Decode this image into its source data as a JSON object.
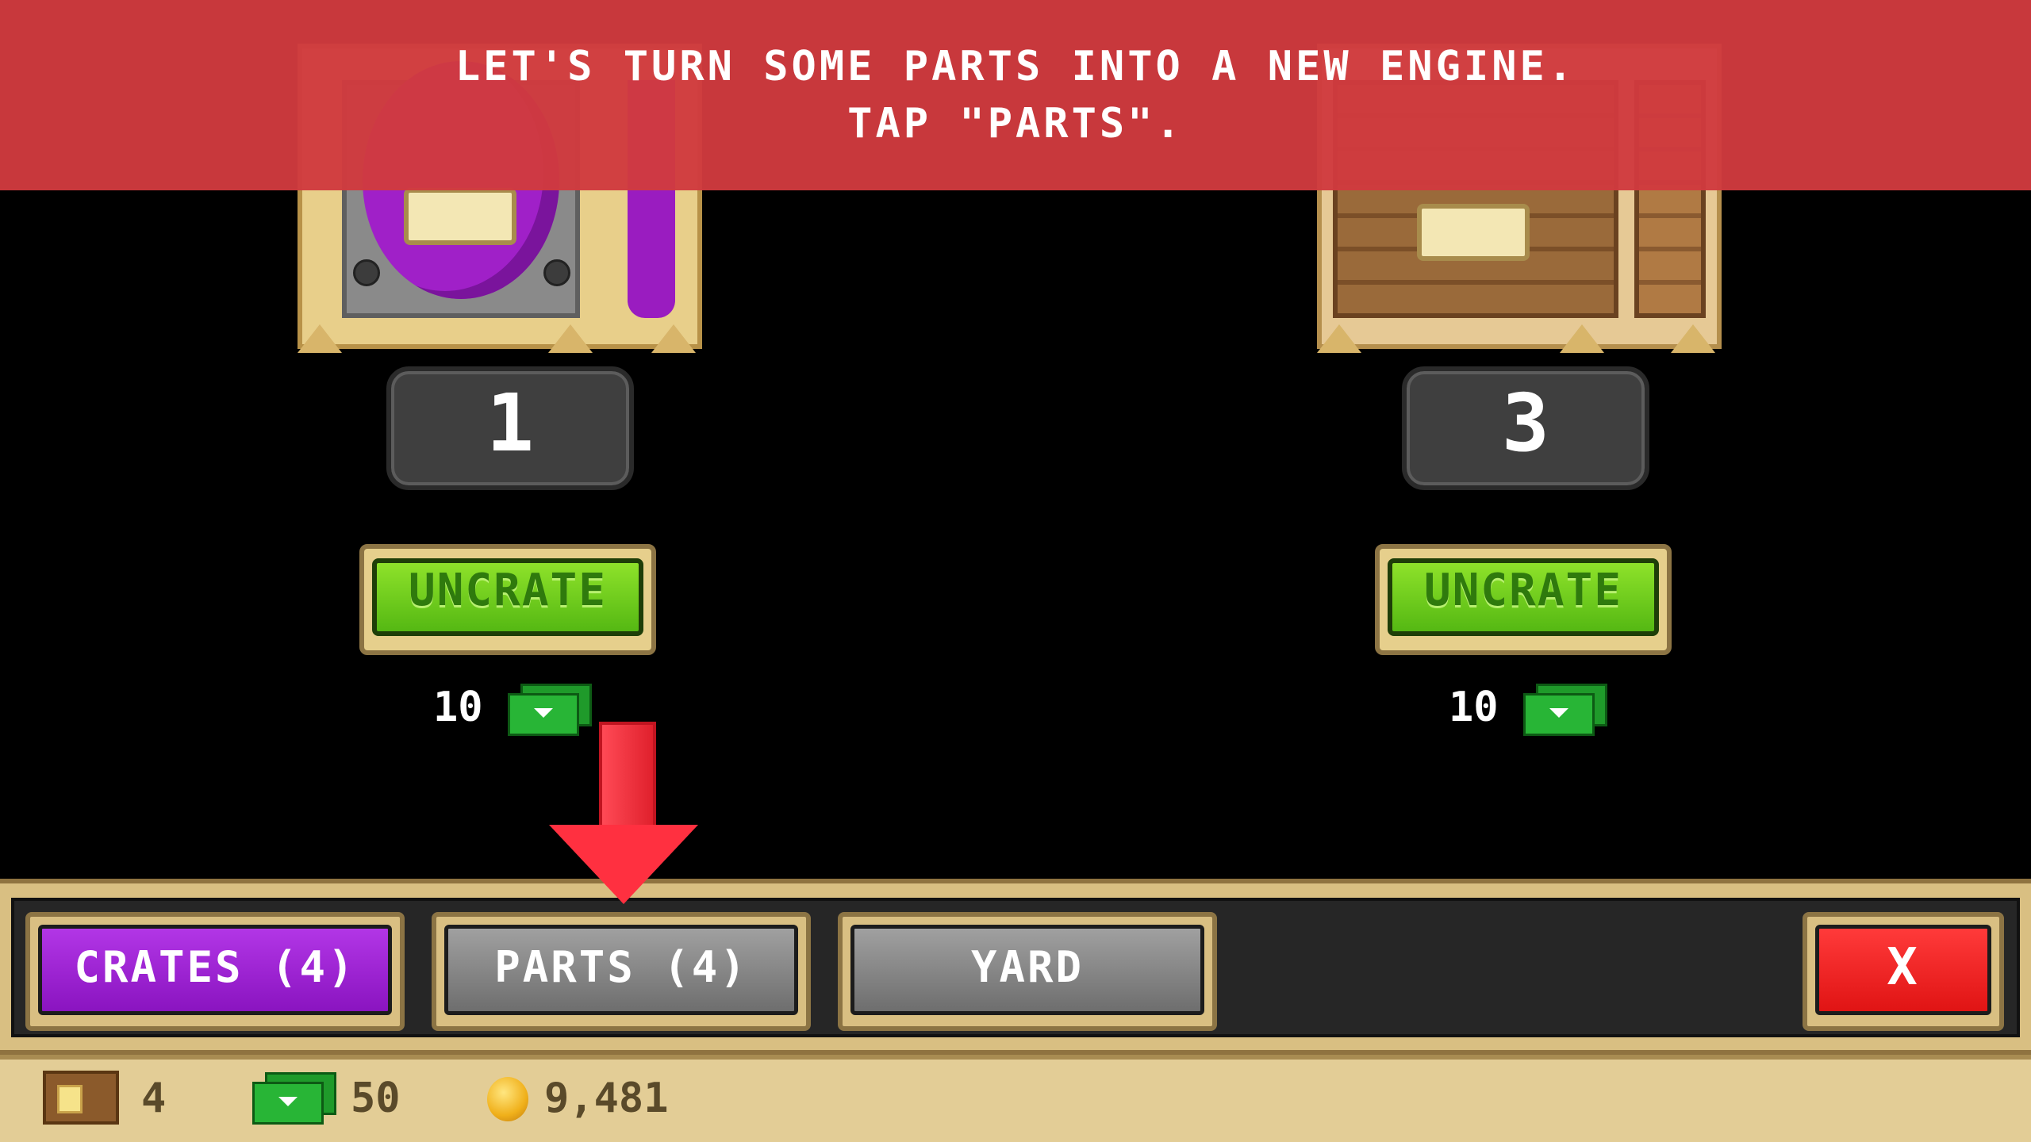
{
  "tutorial": {
    "line1": "LET'S TURN SOME PARTS INTO A NEW ENGINE.",
    "line2": "TAP \"PARTS\"."
  },
  "crates": [
    {
      "type": "purple",
      "count": "1",
      "button": "UNCRATE",
      "cost": "10",
      "cost_icon": "cash-icon"
    },
    {
      "type": "wooden",
      "count": "3",
      "button": "UNCRATE",
      "cost": "10",
      "cost_icon": "cash-icon"
    }
  ],
  "tabs": {
    "crates": "CRATES (4)",
    "parts": "PARTS (4)",
    "yard": "YARD",
    "close": "X"
  },
  "footer": {
    "crates": {
      "icon": "crate-icon",
      "value": "4"
    },
    "cash": {
      "icon": "cash-icon",
      "value": "50"
    },
    "coins": {
      "icon": "coin-icon",
      "value": "9,481"
    }
  },
  "colors": {
    "banner": "#d03a3e",
    "crates_tab": "#9a22d2",
    "close_tab": "#e82020",
    "uncrate": "#6cc81c"
  }
}
